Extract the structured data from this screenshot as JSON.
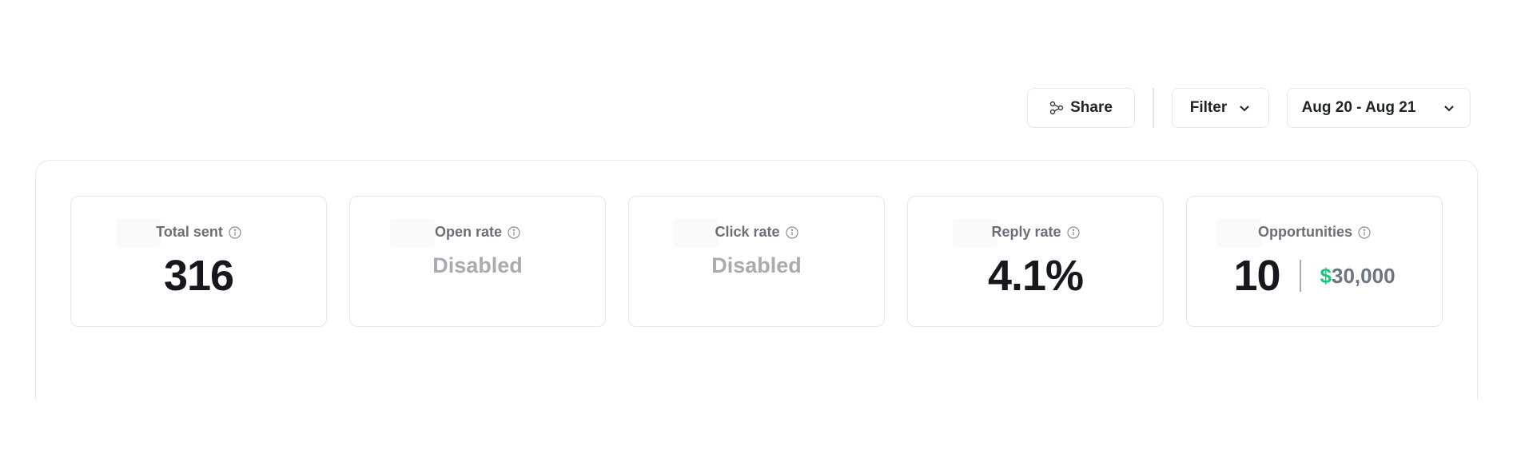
{
  "toolbar": {
    "share_label": "Share",
    "filter_label": "Filter",
    "date_range": "Aug 20 - Aug 21"
  },
  "stats": [
    {
      "label": "Total sent",
      "value": "316",
      "disabled": false
    },
    {
      "label": "Open rate",
      "value": "Disabled",
      "disabled": true
    },
    {
      "label": "Click rate",
      "value": "Disabled",
      "disabled": true
    },
    {
      "label": "Reply rate",
      "value": "4.1%",
      "disabled": false
    },
    {
      "label": "Opportunities",
      "count": "10",
      "currency_symbol": "$",
      "amount": "30,000"
    }
  ],
  "colors": {
    "money_symbol": "#1fc47a",
    "disabled_text": "#a9abb0",
    "label_text": "#6b6e76"
  }
}
